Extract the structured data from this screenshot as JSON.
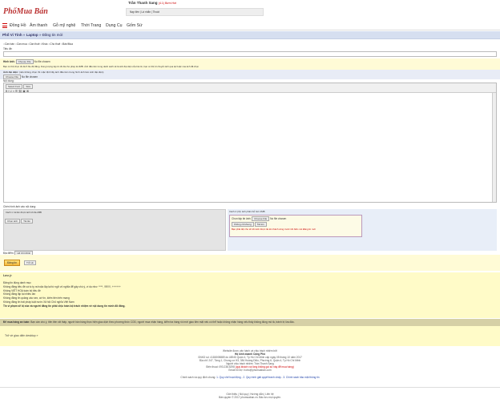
{
  "logo": {
    "main": "Phố",
    "accent": "Mua Bán"
  },
  "user": {
    "name": "Trần Thanh Sang",
    "version": "(4.1) Bơm Hơi",
    "links": [
      "Nạp tiền",
      "Lá nhắn",
      "Thoát"
    ]
  },
  "menu": [
    "Đồng Hồ",
    "Âm thanh",
    "Gỗ mỹ nghệ",
    "Thời Trang",
    "Dụng Cụ",
    "Gốm Sứ"
  ],
  "breadcrumb": [
    "Phố Vi Tính",
    "Laptop",
    "Đăng tin mới"
  ],
  "post_type": [
    "Cần bán",
    "Cần mua",
    "Cần thuê",
    "Khác",
    "Cho thuê",
    "Bán/Mua"
  ],
  "form": {
    "title_label": "Tiêu đề:",
    "image_label": "Hình ảnh:",
    "choose_file": "Choose File",
    "no_file": "No file chosen",
    "image_note": "Bạn có thể chọn tối đa 5 file để đăng. Dung lượng tập tin tối đa cho phép là 2MB. Ảnh đầu tiên trong danh sách sẽ là ảnh đại diện của bài tin, bạn có thể di chuyển ảnh qua lại hoặc xóa ảnh đã chọn",
    "avatar_label": "Ảnh đại diện:",
    "avatar_note": "(nếu không chọn thì mặc định lấy ảnh đầu tiên trong hình ảnh làm ảnh đại diện)",
    "content_label": "Nội dung:",
    "font_select": "Select Font",
    "size_select": "Size",
    "insert_img_label": "Chèn hình ảnh vào nội dung:",
    "pane1_label": "Cách 1: tải lên được ảnh tối đa 2MB",
    "pane2_label": "Cách 2 (cũ): ảnh phải nhỏ hơn 2MB",
    "pick_img_btn": "Chọn ảnh",
    "upload_btn": "Tải lên",
    "dlg_title": "Chọn tập tin ảnh:",
    "dlg_select": "Không cố khung",
    "dlg_upload": "Tải lên",
    "dlg_warn": "Bạn phải đợi cho tới khi ảnh được tải lên thành công trước khi bấm nút Đăng tin mới",
    "location_label": "Địa điểm:",
    "location_value": "Hồ Chí Minh",
    "submit": "Đăng tin",
    "cancel": "Trở về"
  },
  "notes": {
    "title": "Lưu ý:",
    "items": [
      "Đăng tin đúng danh mục",
      "Không đăng tiêu đề cá tu tỵ ra hoặc lặp lại từ ngữ vô nghĩa để gây chú ý, ví dụ như: ****, !!!!!!!!!, ++++++",
      "Không VIẾT HOA toàn bộ tiêu đề",
      "Không đăng lặp lại nhiều lần",
      "Không đăng tin quảng cáo sex, cờ tín, kiếm tiền trên mạng",
      "Không đăng tin trái pháp luật nước Xã hội Chủ nghĩa Việt Nam",
      "Tin vi phạm sẽ bị xóa và người đăng tin phải chịu toàn bộ trách nhiệm về nội dung tin mình đã đăng."
    ]
  },
  "disclaimer": {
    "label": "Để mua hàng an toàn:",
    "text": "Bạn cần chú ý, tiên tiền rất thấp, người bán hàng thực hiện giao dịch theo phương thức COD, người mua nhận hàng, kiểm tra hàng rồi mới giao tiền mặt nếu có thể hoặc không nhận hàng nếu thấy không đúng mô tả, tránh bị lừa đảo."
  },
  "back_link": "Trở về giao diện desktop",
  "footer": {
    "lines": [
      "Website được vận hành và chịu trách nhiệm bởi",
      "Hộ kinh doanh Công Phố",
      "GNKD số: 41D8005889 do UBND Quận 4, Tp Hồ Chí Minh cấp ngày 05 tháng 10 năm 2017",
      "Địa chỉ: 247, Tầng 1, Chung cư H3, 384 Hoàng Diệu, Phường 6, Quận 4, Tp Hồ Chí Minh",
      "Người chịu trách nhiệm: Trần Thanh Sang",
      "Điện thoại: 093.238.5298",
      "Email: hotro@phomuaban.com"
    ],
    "phone_note": "(quý khách vui lòng không gọi số này để mua hàng)",
    "email_label": "Email hỗ trợ:",
    "email": "hotro@phomuaban.com",
    "policy_prefix": "Chính sách và quy định chung:",
    "policies": [
      "1. Quy chế hoạt động",
      "2. Quy trình giải quyết tranh chấp",
      "3. Chính sách bảo mật thông tin"
    ],
    "bottom_links": [
      "Giới thiệu",
      "Nội quy",
      "Hướng dẫn",
      "Liên hệ"
    ],
    "copyright": "Bản quyền © 2017 phomuaban.vn. Bảo lưu mọi quyền."
  },
  "colors": {
    "brand": "#e8721d",
    "accent_red": "#cc0000",
    "crumb_bg": "#d6dff0",
    "note_bg": "#fffbc8"
  }
}
